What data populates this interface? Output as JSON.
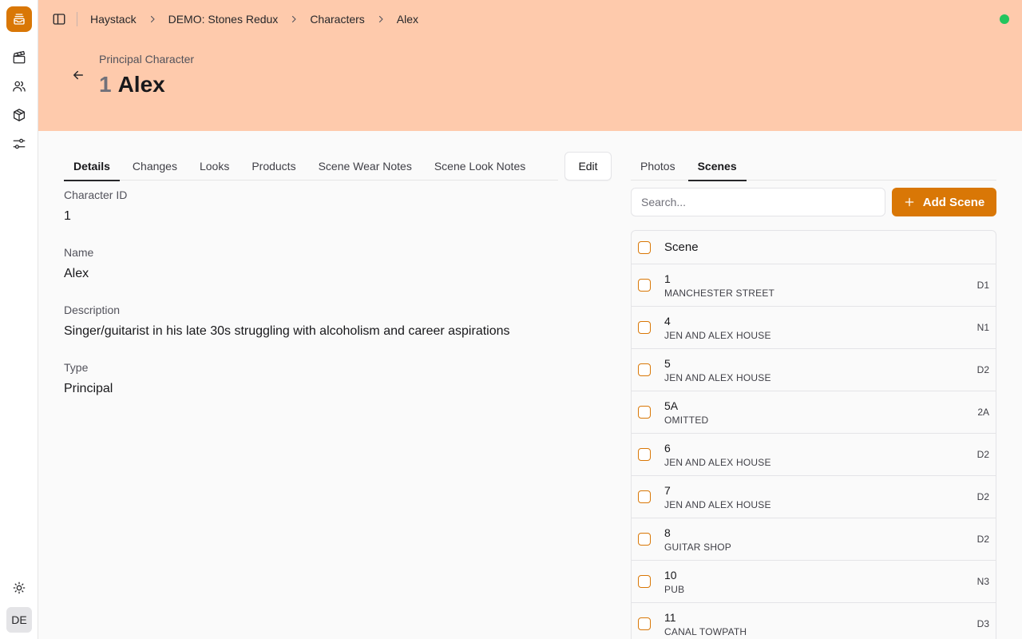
{
  "sidebar": {
    "logo_icon": "inbox-stack-icon",
    "items": [
      {
        "icon": "clapperboard-icon",
        "label": ""
      },
      {
        "icon": "users-icon",
        "label": ""
      },
      {
        "icon": "package-icon",
        "label": ""
      },
      {
        "icon": "sliders-icon",
        "label": ""
      }
    ],
    "theme_icon": "sun-icon",
    "avatar_initials": "DE"
  },
  "header": {
    "breadcrumbs": [
      "Haystack",
      "DEMO: Stones Redux",
      "Characters",
      "Alex"
    ],
    "status_color": "#22c55e",
    "subtitle": "Principal Character",
    "title_number": "1",
    "title_name": "Alex",
    "background_color": "#fecaac"
  },
  "left_tabs": [
    "Details",
    "Changes",
    "Looks",
    "Products",
    "Scene Wear Notes",
    "Scene Look Notes"
  ],
  "active_left_tab": "Details",
  "edit_label": "Edit",
  "details": {
    "character_id_label": "Character ID",
    "character_id": "1",
    "name_label": "Name",
    "name": "Alex",
    "description_label": "Description",
    "description": "Singer/guitarist in his late 30s struggling with alcoholism and career aspirations",
    "type_label": "Type",
    "type": "Principal"
  },
  "right_tabs": [
    "Photos",
    "Scenes"
  ],
  "active_right_tab": "Scenes",
  "search_placeholder": "Search...",
  "add_scene_label": "Add Scene",
  "accent_color": "#d97706",
  "table": {
    "header": "Scene",
    "rows": [
      {
        "scene": "1",
        "location": "MANCHESTER STREET",
        "code": "D1"
      },
      {
        "scene": "4",
        "location": "JEN AND ALEX HOUSE",
        "code": "N1"
      },
      {
        "scene": "5",
        "location": "JEN AND ALEX HOUSE",
        "code": "D2"
      },
      {
        "scene": "5A",
        "location": "OMITTED",
        "code": "2A"
      },
      {
        "scene": "6",
        "location": "JEN AND ALEX HOUSE",
        "code": "D2"
      },
      {
        "scene": "7",
        "location": "JEN AND ALEX HOUSE",
        "code": "D2"
      },
      {
        "scene": "8",
        "location": "GUITAR SHOP",
        "code": "D2"
      },
      {
        "scene": "10",
        "location": "PUB",
        "code": "N3"
      },
      {
        "scene": "11",
        "location": "CANAL TOWPATH",
        "code": "D3"
      }
    ]
  }
}
